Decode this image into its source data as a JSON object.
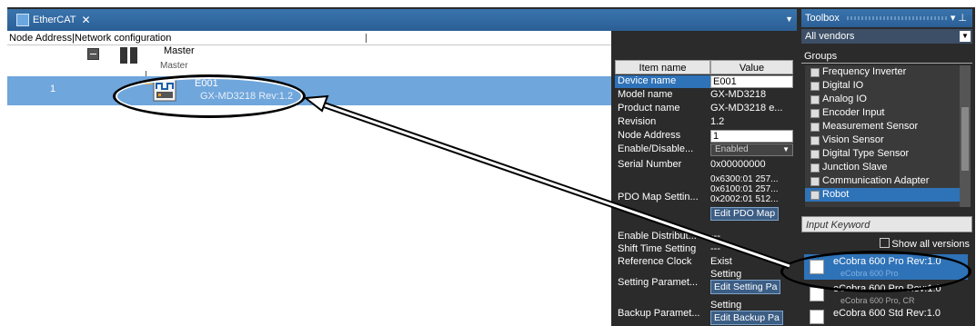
{
  "editor": {
    "tab_label": "EtherCAT",
    "column_header": "Node Address|Network configuration",
    "master_label": "Master",
    "master_sub": "Master",
    "row_number": "1",
    "device_name": "E001",
    "device_model": "GX-MD3218 Rev:1.2"
  },
  "properties": {
    "headers": {
      "name": "Item name",
      "value": "Value"
    },
    "rows": [
      {
        "key": "Device name",
        "value": "E001"
      },
      {
        "key": "Model name",
        "value": "GX-MD3218"
      },
      {
        "key": "Product name",
        "value": "GX-MD3218 e..."
      },
      {
        "key": "Revision",
        "value": "1.2"
      },
      {
        "key": "Node Address",
        "value": "1"
      },
      {
        "key": "Enable/Disable...",
        "value": "Enabled"
      },
      {
        "key": "Serial Number",
        "value": "0x00000000"
      },
      {
        "key": "PDO Map Settin...",
        "value_lines": [
          "0x6300:01 257...",
          "0x6100:01 257...",
          "0x2002:01 512..."
        ],
        "button": "Edit PDO Map"
      },
      {
        "key": "Enable Distribut...",
        "value": "---"
      },
      {
        "key": "Shift Time Setting",
        "value": "---"
      },
      {
        "key": "Reference Clock",
        "value": "Exist"
      },
      {
        "key": "Setting Paramet...",
        "value": "Setting",
        "button": "Edit Setting Pa"
      },
      {
        "key": "Backup Paramet...",
        "value": "Setting",
        "button": "Edit Backup Pa"
      }
    ]
  },
  "toolbox": {
    "title": "Toolbox",
    "vendor": "All vendors",
    "groups_label": "Groups",
    "groups": [
      "Frequency Inverter",
      "Digital IO",
      "Analog IO",
      "Encoder Input",
      "Measurement Sensor",
      "Vision Sensor",
      "Digital Type Sensor",
      "Junction Slave",
      "Communication Adapter",
      "Robot"
    ],
    "keyword_placeholder": "Input Keyword",
    "all_versions": "Show all versions",
    "results": [
      {
        "name": "eCobra 600 Pro Rev:1.0",
        "sub": "eCobra 600 Pro"
      },
      {
        "name": "eCobra 600 Pro Rev:1.0",
        "sub": "eCobra 600 Pro, CR"
      },
      {
        "name": "eCobra 600 Std Rev:1.0",
        "sub": ""
      }
    ]
  },
  "colors": {
    "selection": "#2e72b8",
    "row_highlight": "#6fa6dc",
    "panel": "#2b2b2b",
    "titlebar": "#3a74ad"
  }
}
